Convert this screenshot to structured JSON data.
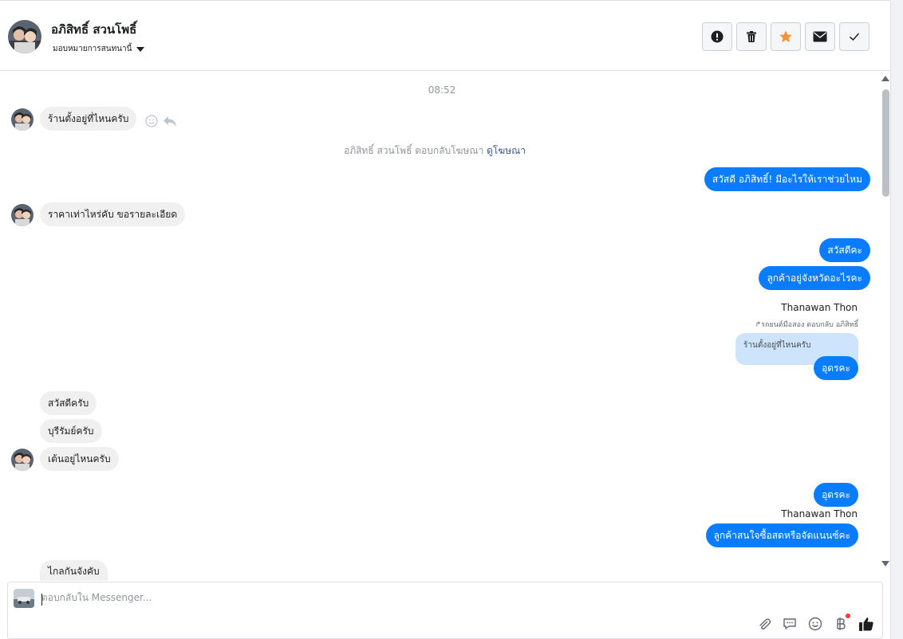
{
  "header": {
    "name": "อภิสิทธิ์ สวนโพธิ์",
    "assign_label": "มอบหมายการสนทนานี้",
    "actions": [
      "mark-spam",
      "delete",
      "star",
      "mark-unread",
      "mark-done"
    ]
  },
  "conversation": {
    "timestamp": "08:52",
    "ad_reply_text": "อภิสิทธิ์ สวนโพธิ์ ตอบกลับโฆษณา",
    "ad_link_label": "ดูโฆษณา",
    "messages": {
      "m1": "ร้านตั้งอยู่ที่ไหนครับ",
      "m2": "สวัสดี อภิสิทธิ์! มีอะไรให้เราช่วยไหม",
      "m3": "ราคาเท่าไหร่คับ ขอรายละเอียด",
      "m4": "สวัสดีคะ",
      "m5": "ลูกค้าอยู่จังหวัดอะไรคะ",
      "sender_1": "Thanawan Thon",
      "reply_note": "↱รถยนต์มือสอง ตอบกลับ อภิสิทธิ์",
      "quoted": "ร้านตั้งอยู่ที่ไหนครับ",
      "m6": "อุดรคะ",
      "m7": "สวัสดีครับ",
      "m8": "บุรีรัมย์ครับ",
      "m9": "เต้นอยู่ไหนครับ",
      "m10": "อุดรคะ",
      "sender_2": "Thanawan Thon",
      "m11": "ลูกค้าสนใจซื้อสดหรือจัดแนนซ์คะ",
      "m12": "ไกลกันจังคับ"
    }
  },
  "composer": {
    "placeholder": "ตอบกลับใน Messenger..."
  },
  "colors": {
    "outgoing": "#0a7cff",
    "incoming": "#f1f0f0",
    "star": "#f7923b",
    "link": "#385898"
  }
}
